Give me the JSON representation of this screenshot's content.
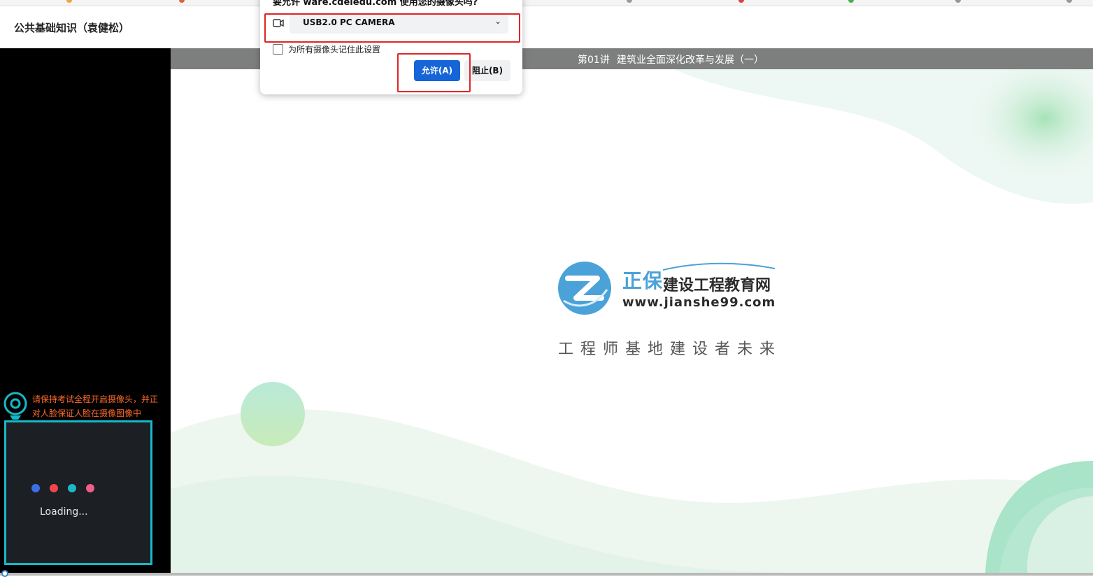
{
  "header": {
    "course_title": "公共基础知识（袁健松）"
  },
  "lesson_bar": {
    "number": "第01讲",
    "title": "建筑业全面深化改革与发展（一）"
  },
  "slide": {
    "logo_main": "正保",
    "logo_sub": "建设工程教育网",
    "logo_url": "www.jianshe99.com",
    "slogan": "工程师基地建设者未来"
  },
  "camera_panel": {
    "warning": "请保持考试全程开启摄像头，并正对人脸保证人脸在摄像图像中",
    "loading": "Loading...",
    "dot_colors": [
      "#3b6fe8",
      "#f0464a",
      "#1cb8c9",
      "#ee5f8a"
    ]
  },
  "permission_popup": {
    "question": "要允许 ware.cdeledu.com 使用您的摄像头吗?",
    "camera_select": "USB2.0 PC CAMERA",
    "remember_label": "为所有摄像头记住此设置",
    "allow_label": "允许(A)",
    "block_label": "阻止(B)"
  }
}
